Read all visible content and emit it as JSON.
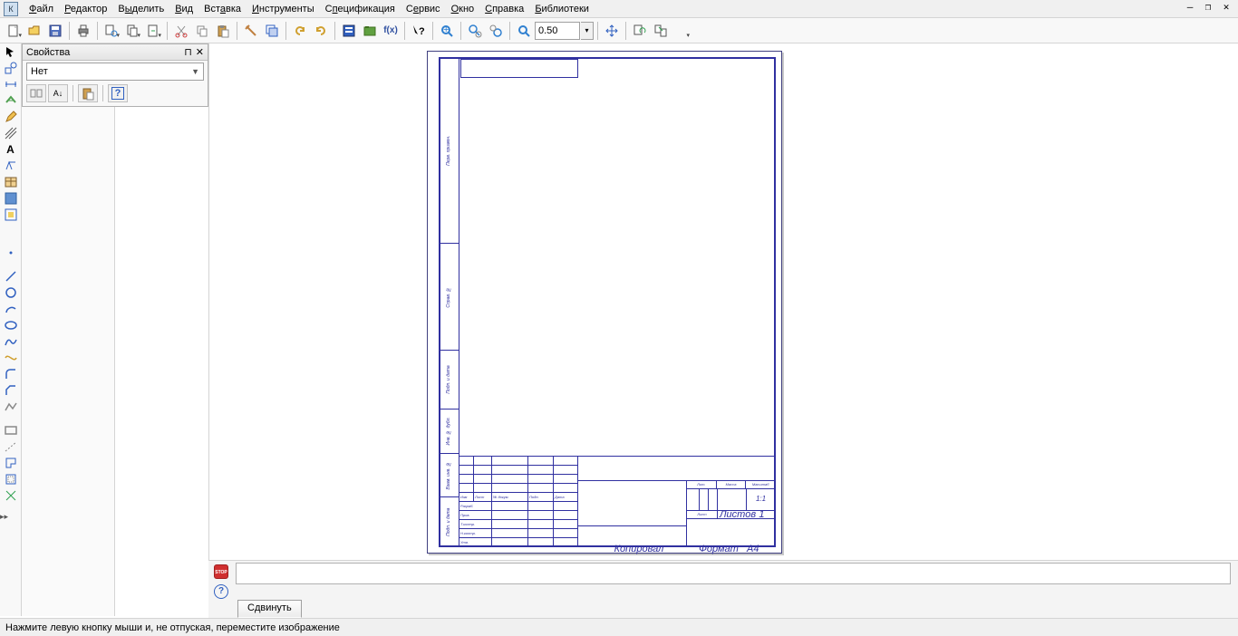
{
  "menu": {
    "items": [
      "Файл",
      "Редактор",
      "Выделить",
      "Вид",
      "Вставка",
      "Инструменты",
      "Спецификация",
      "Сервис",
      "Окно",
      "Справка",
      "Библиотеки"
    ]
  },
  "toolbar": {
    "zoom_value": "0.50"
  },
  "props": {
    "title": "Свойства",
    "combo_value": "Нет"
  },
  "titleblock": {
    "r_izm": "Изм",
    "r_list": "Лист",
    "r_ndokum": "№ докум.",
    "r_podp": "Подп.",
    "r_data": "Дата",
    "r_razrab": "Разраб.",
    "r_prov": "Пров.",
    "r_tkontr": "Т.контр.",
    "r_nkontr": "Н.контр.",
    "r_utv": "Утв.",
    "h_lit": "Лит.",
    "h_massa": "Масса",
    "h_masshtab": "Масштаб",
    "scale": "1:1",
    "f_list": "Лист",
    "f_listov": "Листов",
    "f_listov_n": "1",
    "foot_kopiroval": "Копировал",
    "foot_format": "Формат",
    "foot_a4": "А4"
  },
  "bottom": {
    "tab": "Сдвинуть",
    "stop": "STOP"
  },
  "status": {
    "text": "Нажмите левую кнопку мыши и, не отпуская, переместите изображение"
  }
}
